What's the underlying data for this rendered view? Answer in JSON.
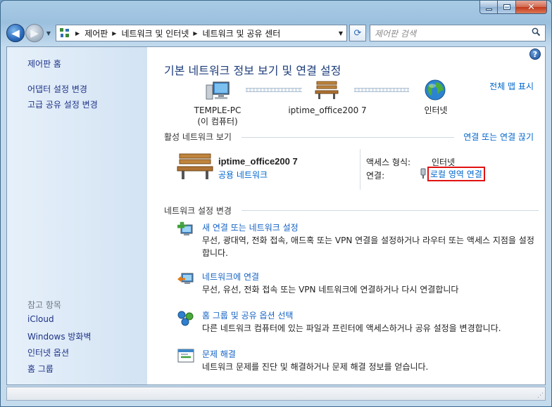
{
  "window": {
    "controls": {
      "minimize_icon": "minimize-icon",
      "maximize_icon": "maximize-icon",
      "close_glyph": "✕"
    }
  },
  "address_bar": {
    "breadcrumbs": [
      "제어판",
      "네트워크 및 인터넷",
      "네트워크 및 공유 센터"
    ],
    "search_placeholder": "제어판 검색"
  },
  "sidebar": {
    "links": [
      "제어판 홈",
      "어댑터 설정 변경",
      "고급 공유 설정 변경"
    ],
    "see_also_heading": "참고 항목",
    "see_also": [
      "iCloud",
      "Windows 방화벽",
      "인터넷 옵션",
      "홈 그룹"
    ]
  },
  "main": {
    "title": "기본 네트워크 정보 보기 및 연결 설정",
    "full_map_link": "전체 맵 표시",
    "map": {
      "computer_name": "TEMPLE-PC",
      "computer_sub": "(이 컴퓨터)",
      "network_name": "iptime_office200  7",
      "internet_label": "인터넷"
    },
    "active_networks": {
      "heading": "활성 네트워크 보기",
      "connect_link": "연결 또는 연결 끊기",
      "network_name": "iptime_office200  7",
      "network_type": "공용 네트워크",
      "access_type_label": "액세스 형식:",
      "access_type_value": "인터넷",
      "connections_label": "연결:",
      "connections_value": "로컬 영역 연결"
    },
    "change_settings": {
      "heading": "네트워크 설정 변경",
      "tasks": [
        {
          "title": "새 연결 또는 네트워크 설정",
          "desc": "무선, 광대역, 전화 접속, 애드혹 또는 VPN 연결을 설정하거나 라우터 또는 액세스 지점을 설정합니다."
        },
        {
          "title": "네트워크에 연결",
          "desc": "무선, 유선, 전화 접속 또는 VPN 네트워크에 연결하거나 다시 연결합니다"
        },
        {
          "title": "홈 그룹 및 공유 옵션 선택",
          "desc": "다른 네트워크 컴퓨터에 있는 파일과 프린터에 액세스하거나 공유 설정을 변경합니다."
        },
        {
          "title": "문제 해결",
          "desc": "네트워크 문제를 진단 및 해결하거나 문제 해결 정보를 얻습니다."
        }
      ]
    }
  },
  "colors": {
    "link": "#0066cc",
    "title": "#1d3d7a",
    "highlight_box": "#e01212",
    "sidebar_link": "#1e3287"
  }
}
